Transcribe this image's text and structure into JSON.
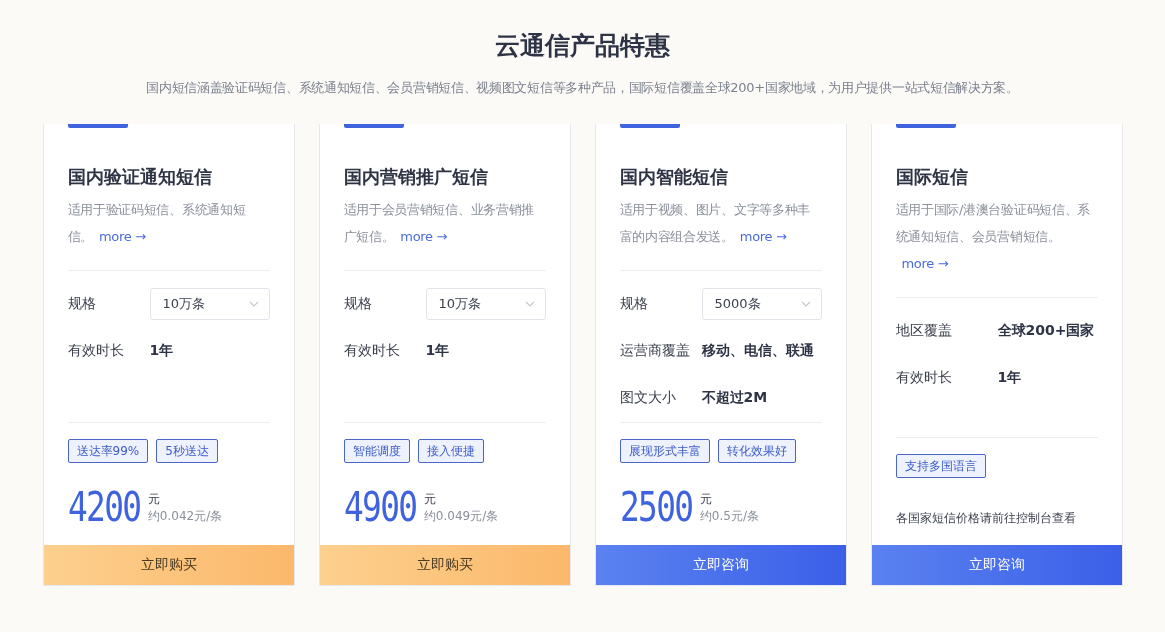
{
  "header": {
    "title": "云通信产品特惠",
    "subtitle": "国内短信涵盖验证码短信、系统通知短信、会员营销短信、视频图文短信等多种产品，国际短信覆盖全球200+国家地域，为用户提供一站式短信解决方案。"
  },
  "cards": [
    {
      "title": "国内验证通知短信",
      "description": "适用于验证码短信、系统通知短信。",
      "more": "more →",
      "specs": [
        {
          "kind": "select",
          "label": "规格",
          "value": "10万条"
        },
        {
          "kind": "text",
          "label": "有效时长",
          "value": "1年"
        }
      ],
      "tags": [
        "送达率99%",
        "5秒送达"
      ],
      "price": {
        "amount": "4200",
        "unit": "元",
        "per_item": "约0.042元/条"
      },
      "button": {
        "kind": "buy",
        "label": "立即购买"
      }
    },
    {
      "title": "国内营销推广短信",
      "description": "适用于会员营销短信、业务营销推广短信。",
      "more": "more →",
      "specs": [
        {
          "kind": "select",
          "label": "规格",
          "value": "10万条"
        },
        {
          "kind": "text",
          "label": "有效时长",
          "value": "1年"
        }
      ],
      "tags": [
        "智能调度",
        "接入便捷"
      ],
      "price": {
        "amount": "4900",
        "unit": "元",
        "per_item": "约0.049元/条"
      },
      "button": {
        "kind": "buy",
        "label": "立即购买"
      }
    },
    {
      "title": "国内智能短信",
      "description": "适用于视频、图片、文字等多种丰富的内容组合发送。",
      "more": "more →",
      "specs": [
        {
          "kind": "select",
          "label": "规格",
          "value": "5000条"
        },
        {
          "kind": "text",
          "label": "运营商覆盖",
          "value": "移动、电信、联通"
        },
        {
          "kind": "text",
          "label": "图文大小",
          "value": "不超过2M"
        }
      ],
      "tags": [
        "展现形式丰富",
        "转化效果好"
      ],
      "price": {
        "amount": "2500",
        "unit": "元",
        "per_item": "约0.5元/条"
      },
      "button": {
        "kind": "consult",
        "label": "立即咨询"
      }
    },
    {
      "title": "国际短信",
      "description": "适用于国际/港澳台验证码短信、系统通知短信、会员营销短信。",
      "more": "more →",
      "specs": [
        {
          "kind": "text",
          "label": "地区覆盖",
          "value": "全球200+国家"
        },
        {
          "kind": "text",
          "label": "有效时长",
          "value": "1年"
        }
      ],
      "tags": [
        "支持多国语言"
      ],
      "note": "各国家短信价格请前往控制台查看",
      "button": {
        "kind": "consult",
        "label": "立即咨询"
      }
    }
  ]
}
